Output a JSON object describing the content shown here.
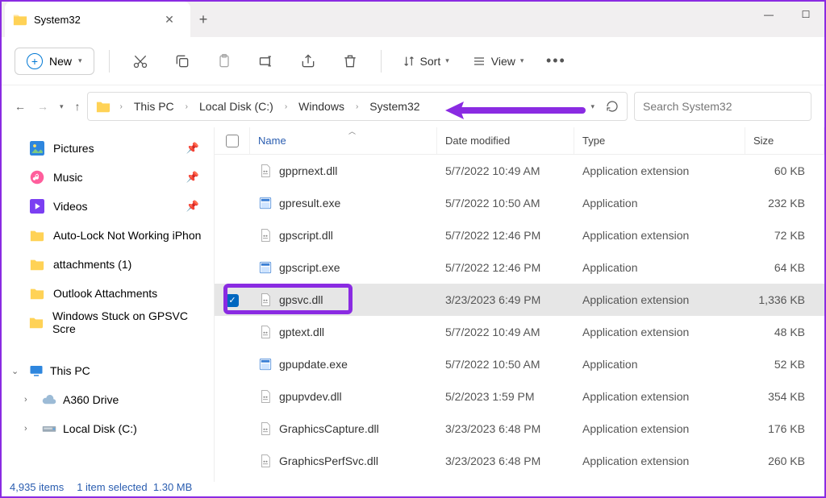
{
  "titlebar": {
    "tab_title": "System32"
  },
  "toolbar": {
    "new_label": "New",
    "sort_label": "Sort",
    "view_label": "View"
  },
  "breadcrumbs": {
    "pc": "This PC",
    "disk": "Local Disk (C:)",
    "win": "Windows",
    "sys": "System32"
  },
  "search": {
    "placeholder": "Search System32"
  },
  "sidebar": {
    "quick": [
      {
        "label": "Pictures",
        "icon": "pictures",
        "pinned": true
      },
      {
        "label": "Music",
        "icon": "music",
        "pinned": true
      },
      {
        "label": "Videos",
        "icon": "videos",
        "pinned": true
      },
      {
        "label": "Auto-Lock Not Working iPhon",
        "icon": "folder",
        "pinned": false
      },
      {
        "label": "attachments (1)",
        "icon": "folder",
        "pinned": false
      },
      {
        "label": "Outlook Attachments",
        "icon": "folder",
        "pinned": false
      },
      {
        "label": "Windows Stuck on GPSVC Scre",
        "icon": "folder",
        "pinned": false
      }
    ],
    "this_pc": "This PC",
    "a360": "A360 Drive",
    "local_disk": "Local Disk (C:)"
  },
  "columns": {
    "name": "Name",
    "date": "Date modified",
    "type": "Type",
    "size": "Size"
  },
  "rows": [
    {
      "name": "gpprnext.dll",
      "date": "5/7/2022 10:49 AM",
      "type": "Application extension",
      "size": "60 KB",
      "icon": "dll",
      "selected": false
    },
    {
      "name": "gpresult.exe",
      "date": "5/7/2022 10:50 AM",
      "type": "Application",
      "size": "232 KB",
      "icon": "exe",
      "selected": false
    },
    {
      "name": "gpscript.dll",
      "date": "5/7/2022 12:46 PM",
      "type": "Application extension",
      "size": "72 KB",
      "icon": "dll",
      "selected": false
    },
    {
      "name": "gpscript.exe",
      "date": "5/7/2022 12:46 PM",
      "type": "Application",
      "size": "64 KB",
      "icon": "exe",
      "selected": false
    },
    {
      "name": "gpsvc.dll",
      "date": "3/23/2023 6:49 PM",
      "type": "Application extension",
      "size": "1,336 KB",
      "icon": "dll",
      "selected": true
    },
    {
      "name": "gptext.dll",
      "date": "5/7/2022 10:49 AM",
      "type": "Application extension",
      "size": "48 KB",
      "icon": "dll",
      "selected": false
    },
    {
      "name": "gpupdate.exe",
      "date": "5/7/2022 10:50 AM",
      "type": "Application",
      "size": "52 KB",
      "icon": "exe",
      "selected": false
    },
    {
      "name": "gpupvdev.dll",
      "date": "5/2/2023 1:59 PM",
      "type": "Application extension",
      "size": "354 KB",
      "icon": "dll",
      "selected": false
    },
    {
      "name": "GraphicsCapture.dll",
      "date": "3/23/2023 6:48 PM",
      "type": "Application extension",
      "size": "176 KB",
      "icon": "dll",
      "selected": false
    },
    {
      "name": "GraphicsPerfSvc.dll",
      "date": "3/23/2023 6:48 PM",
      "type": "Application extension",
      "size": "260 KB",
      "icon": "dll",
      "selected": false
    }
  ],
  "status": {
    "items": "4,935 items",
    "selected": "1 item selected",
    "size": "1.30 MB"
  }
}
